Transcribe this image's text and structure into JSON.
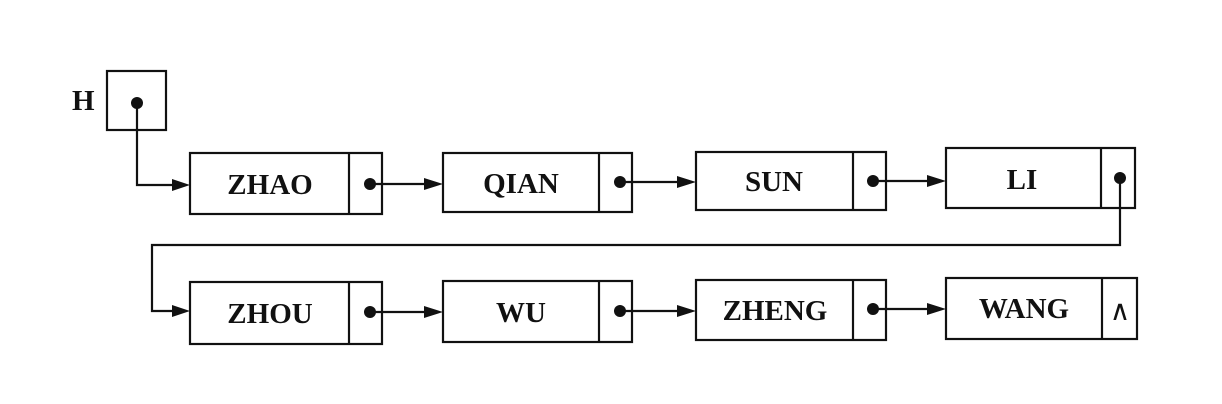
{
  "head": {
    "label": "H"
  },
  "nodes": [
    {
      "data": "ZHAO"
    },
    {
      "data": "QIAN"
    },
    {
      "data": "SUN"
    },
    {
      "data": "LI"
    },
    {
      "data": "ZHOU"
    },
    {
      "data": "WU"
    },
    {
      "data": "ZHENG"
    },
    {
      "data": "WANG",
      "null_symbol": "∧"
    }
  ]
}
